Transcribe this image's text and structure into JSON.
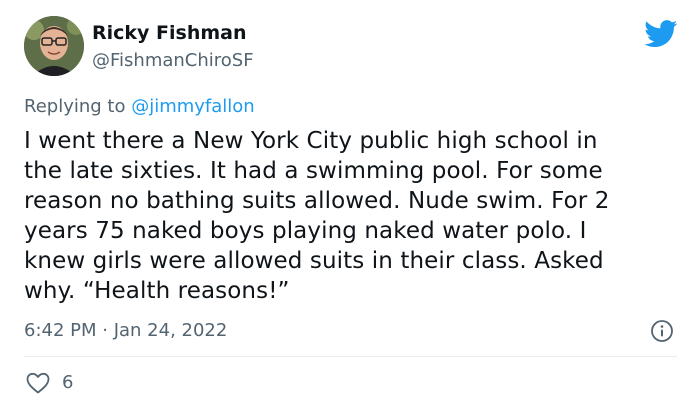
{
  "author": {
    "name": "Ricky Fishman",
    "handle": "@FishmanChiroSF"
  },
  "reply": {
    "prefix": "Replying to ",
    "target": "@jimmyfallon"
  },
  "tweet": {
    "lines": [
      "I went there a New York City public high school in",
      "the late sixties. It had a swimming pool. For some",
      "reason no bathing suits allowed. Nude swim. For 2",
      "years 75 naked boys playing naked water polo. I",
      "knew girls were allowed suits in their class. Asked",
      "why. “Health reasons!”"
    ],
    "timestamp": "6:42 PM · Jan 24, 2022"
  },
  "engagement": {
    "likes": "6"
  },
  "icons": {
    "brand": "twitter-bird-icon",
    "info": "info-icon",
    "like": "heart-icon"
  },
  "colors": {
    "brand": "#1d9bf0",
    "text": "#0f1419",
    "secondary": "#536471",
    "divider": "#e6ecf0"
  }
}
